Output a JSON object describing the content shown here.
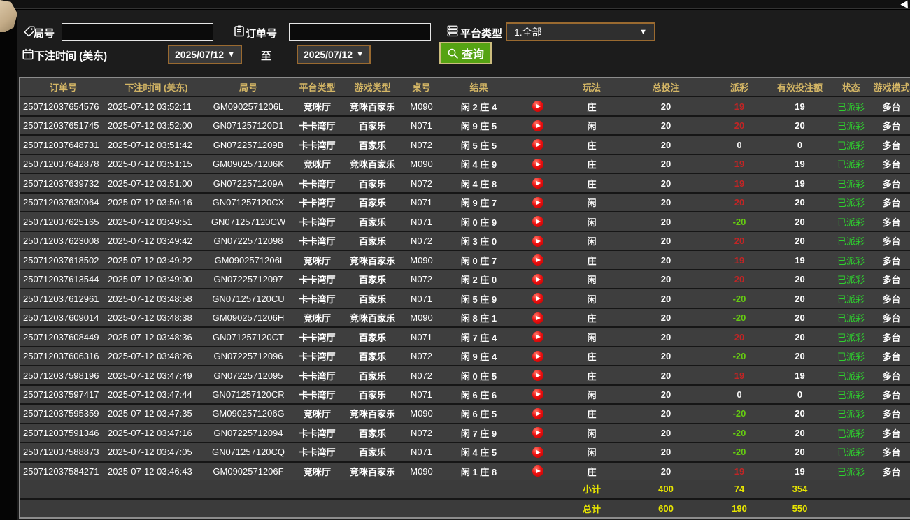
{
  "colors": {
    "gold": "#d4b665",
    "payout_pos": "#c22525",
    "payout_neg": "#66cc11",
    "status_green": "#2ed12e",
    "footer_yellow": "#e8e600",
    "button_green": "#55a313",
    "border_orange": "#9a6a30"
  },
  "filters": {
    "round_label": "局号",
    "round_value": "",
    "order_label": "订单号",
    "order_value": "",
    "platform_label": "平台类型",
    "platform_value": "1.全部",
    "time_label": "下注时间 (美东)",
    "date_from": "2025/07/12",
    "to_label": "至",
    "date_to": "2025/07/12",
    "query_label": "查询"
  },
  "table": {
    "headers": {
      "order": "订单号",
      "time": "下注时间 (美东)",
      "round": "局号",
      "platform": "平台类型",
      "game": "游戏类型",
      "table_no": "桌号",
      "result": "结果",
      "play": "",
      "bet": "玩法",
      "total": "总投注",
      "payout": "派彩",
      "valid": "有效投注额",
      "status": "状态",
      "mode": "游戏模式"
    },
    "rows": [
      {
        "order": "250712037654576",
        "time": "2025-07-12 03:52:11",
        "round": "GM0902571206L",
        "platform": "竞咪厅",
        "game": "竞咪百家乐",
        "table_no": "M090",
        "result": "闲 2 庄 4",
        "bet": "庄",
        "total": "20",
        "payout": "19",
        "payout_tone": "pos",
        "valid": "19",
        "status": "已派彩",
        "mode": "多台"
      },
      {
        "order": "250712037651745",
        "time": "2025-07-12 03:52:00",
        "round": "GN071257120D1",
        "platform": "卡卡湾厅",
        "game": "百家乐",
        "table_no": "N071",
        "result": "闲 9 庄 5",
        "bet": "闲",
        "total": "20",
        "payout": "20",
        "payout_tone": "pos",
        "valid": "20",
        "status": "已派彩",
        "mode": "多台"
      },
      {
        "order": "250712037648731",
        "time": "2025-07-12 03:51:42",
        "round": "GN0722571209B",
        "platform": "卡卡湾厅",
        "game": "百家乐",
        "table_no": "N072",
        "result": "闲 5 庄 5",
        "bet": "庄",
        "total": "20",
        "payout": "0",
        "payout_tone": "zero",
        "valid": "0",
        "status": "已派彩",
        "mode": "多台"
      },
      {
        "order": "250712037642878",
        "time": "2025-07-12 03:51:15",
        "round": "GM0902571206K",
        "platform": "竞咪厅",
        "game": "竞咪百家乐",
        "table_no": "M090",
        "result": "闲 4 庄 9",
        "bet": "庄",
        "total": "20",
        "payout": "19",
        "payout_tone": "pos",
        "valid": "19",
        "status": "已派彩",
        "mode": "多台"
      },
      {
        "order": "250712037639732",
        "time": "2025-07-12 03:51:00",
        "round": "GN0722571209A",
        "platform": "卡卡湾厅",
        "game": "百家乐",
        "table_no": "N072",
        "result": "闲 4 庄 8",
        "bet": "庄",
        "total": "20",
        "payout": "19",
        "payout_tone": "pos",
        "valid": "19",
        "status": "已派彩",
        "mode": "多台"
      },
      {
        "order": "250712037630064",
        "time": "2025-07-12 03:50:16",
        "round": "GN071257120CX",
        "platform": "卡卡湾厅",
        "game": "百家乐",
        "table_no": "N071",
        "result": "闲 9 庄 7",
        "bet": "闲",
        "total": "20",
        "payout": "20",
        "payout_tone": "pos",
        "valid": "20",
        "status": "已派彩",
        "mode": "多台"
      },
      {
        "order": "250712037625165",
        "time": "2025-07-12 03:49:51",
        "round": "GN071257120CW",
        "platform": "卡卡湾厅",
        "game": "百家乐",
        "table_no": "N071",
        "result": "闲 0 庄 9",
        "bet": "闲",
        "total": "20",
        "payout": "-20",
        "payout_tone": "neg",
        "valid": "20",
        "status": "已派彩",
        "mode": "多台"
      },
      {
        "order": "250712037623008",
        "time": "2025-07-12 03:49:42",
        "round": "GN07225712098",
        "platform": "卡卡湾厅",
        "game": "百家乐",
        "table_no": "N072",
        "result": "闲 3 庄 0",
        "bet": "闲",
        "total": "20",
        "payout": "20",
        "payout_tone": "pos",
        "valid": "20",
        "status": "已派彩",
        "mode": "多台"
      },
      {
        "order": "250712037618502",
        "time": "2025-07-12 03:49:22",
        "round": "GM0902571206I",
        "platform": "竞咪厅",
        "game": "竞咪百家乐",
        "table_no": "M090",
        "result": "闲 0 庄 7",
        "bet": "庄",
        "total": "20",
        "payout": "19",
        "payout_tone": "pos",
        "valid": "19",
        "status": "已派彩",
        "mode": "多台"
      },
      {
        "order": "250712037613544",
        "time": "2025-07-12 03:49:00",
        "round": "GN07225712097",
        "platform": "卡卡湾厅",
        "game": "百家乐",
        "table_no": "N072",
        "result": "闲 2 庄 0",
        "bet": "闲",
        "total": "20",
        "payout": "20",
        "payout_tone": "pos",
        "valid": "20",
        "status": "已派彩",
        "mode": "多台"
      },
      {
        "order": "250712037612961",
        "time": "2025-07-12 03:48:58",
        "round": "GN071257120CU",
        "platform": "卡卡湾厅",
        "game": "百家乐",
        "table_no": "N071",
        "result": "闲 5 庄 9",
        "bet": "闲",
        "total": "20",
        "payout": "-20",
        "payout_tone": "neg",
        "valid": "20",
        "status": "已派彩",
        "mode": "多台"
      },
      {
        "order": "250712037609014",
        "time": "2025-07-12 03:48:38",
        "round": "GM0902571206H",
        "platform": "竞咪厅",
        "game": "竞咪百家乐",
        "table_no": "M090",
        "result": "闲 8 庄 1",
        "bet": "庄",
        "total": "20",
        "payout": "-20",
        "payout_tone": "neg",
        "valid": "20",
        "status": "已派彩",
        "mode": "多台"
      },
      {
        "order": "250712037608449",
        "time": "2025-07-12 03:48:36",
        "round": "GN071257120CT",
        "platform": "卡卡湾厅",
        "game": "百家乐",
        "table_no": "N071",
        "result": "闲 7 庄 4",
        "bet": "闲",
        "total": "20",
        "payout": "20",
        "payout_tone": "pos",
        "valid": "20",
        "status": "已派彩",
        "mode": "多台"
      },
      {
        "order": "250712037606316",
        "time": "2025-07-12 03:48:26",
        "round": "GN07225712096",
        "platform": "卡卡湾厅",
        "game": "百家乐",
        "table_no": "N072",
        "result": "闲 9 庄 4",
        "bet": "庄",
        "total": "20",
        "payout": "-20",
        "payout_tone": "neg",
        "valid": "20",
        "status": "已派彩",
        "mode": "多台"
      },
      {
        "order": "250712037598196",
        "time": "2025-07-12 03:47:49",
        "round": "GN07225712095",
        "platform": "卡卡湾厅",
        "game": "百家乐",
        "table_no": "N072",
        "result": "闲 0 庄 5",
        "bet": "庄",
        "total": "20",
        "payout": "19",
        "payout_tone": "pos",
        "valid": "19",
        "status": "已派彩",
        "mode": "多台"
      },
      {
        "order": "250712037597417",
        "time": "2025-07-12 03:47:44",
        "round": "GN071257120CR",
        "platform": "卡卡湾厅",
        "game": "百家乐",
        "table_no": "N071",
        "result": "闲 6 庄 6",
        "bet": "闲",
        "total": "20",
        "payout": "0",
        "payout_tone": "zero",
        "valid": "0",
        "status": "已派彩",
        "mode": "多台"
      },
      {
        "order": "250712037595359",
        "time": "2025-07-12 03:47:35",
        "round": "GM0902571206G",
        "platform": "竞咪厅",
        "game": "竞咪百家乐",
        "table_no": "M090",
        "result": "闲 6 庄 5",
        "bet": "庄",
        "total": "20",
        "payout": "-20",
        "payout_tone": "neg",
        "valid": "20",
        "status": "已派彩",
        "mode": "多台"
      },
      {
        "order": "250712037591346",
        "time": "2025-07-12 03:47:16",
        "round": "GN07225712094",
        "platform": "卡卡湾厅",
        "game": "百家乐",
        "table_no": "N072",
        "result": "闲 7 庄 9",
        "bet": "闲",
        "total": "20",
        "payout": "-20",
        "payout_tone": "neg",
        "valid": "20",
        "status": "已派彩",
        "mode": "多台"
      },
      {
        "order": "250712037588873",
        "time": "2025-07-12 03:47:05",
        "round": "GN071257120CQ",
        "platform": "卡卡湾厅",
        "game": "百家乐",
        "table_no": "N071",
        "result": "闲 4 庄 5",
        "bet": "闲",
        "total": "20",
        "payout": "-20",
        "payout_tone": "neg",
        "valid": "20",
        "status": "已派彩",
        "mode": "多台"
      },
      {
        "order": "250712037584271",
        "time": "2025-07-12 03:46:43",
        "round": "GM0902571206F",
        "platform": "竞咪厅",
        "game": "竞咪百家乐",
        "table_no": "M090",
        "result": "闲 1 庄 8",
        "bet": "庄",
        "total": "20",
        "payout": "19",
        "payout_tone": "pos",
        "valid": "19",
        "status": "已派彩",
        "mode": "多台"
      }
    ],
    "footer": [
      {
        "label": "小计",
        "total": "400",
        "payout": "74",
        "valid": "354"
      },
      {
        "label": "总计",
        "total": "600",
        "payout": "190",
        "valid": "550"
      }
    ]
  }
}
